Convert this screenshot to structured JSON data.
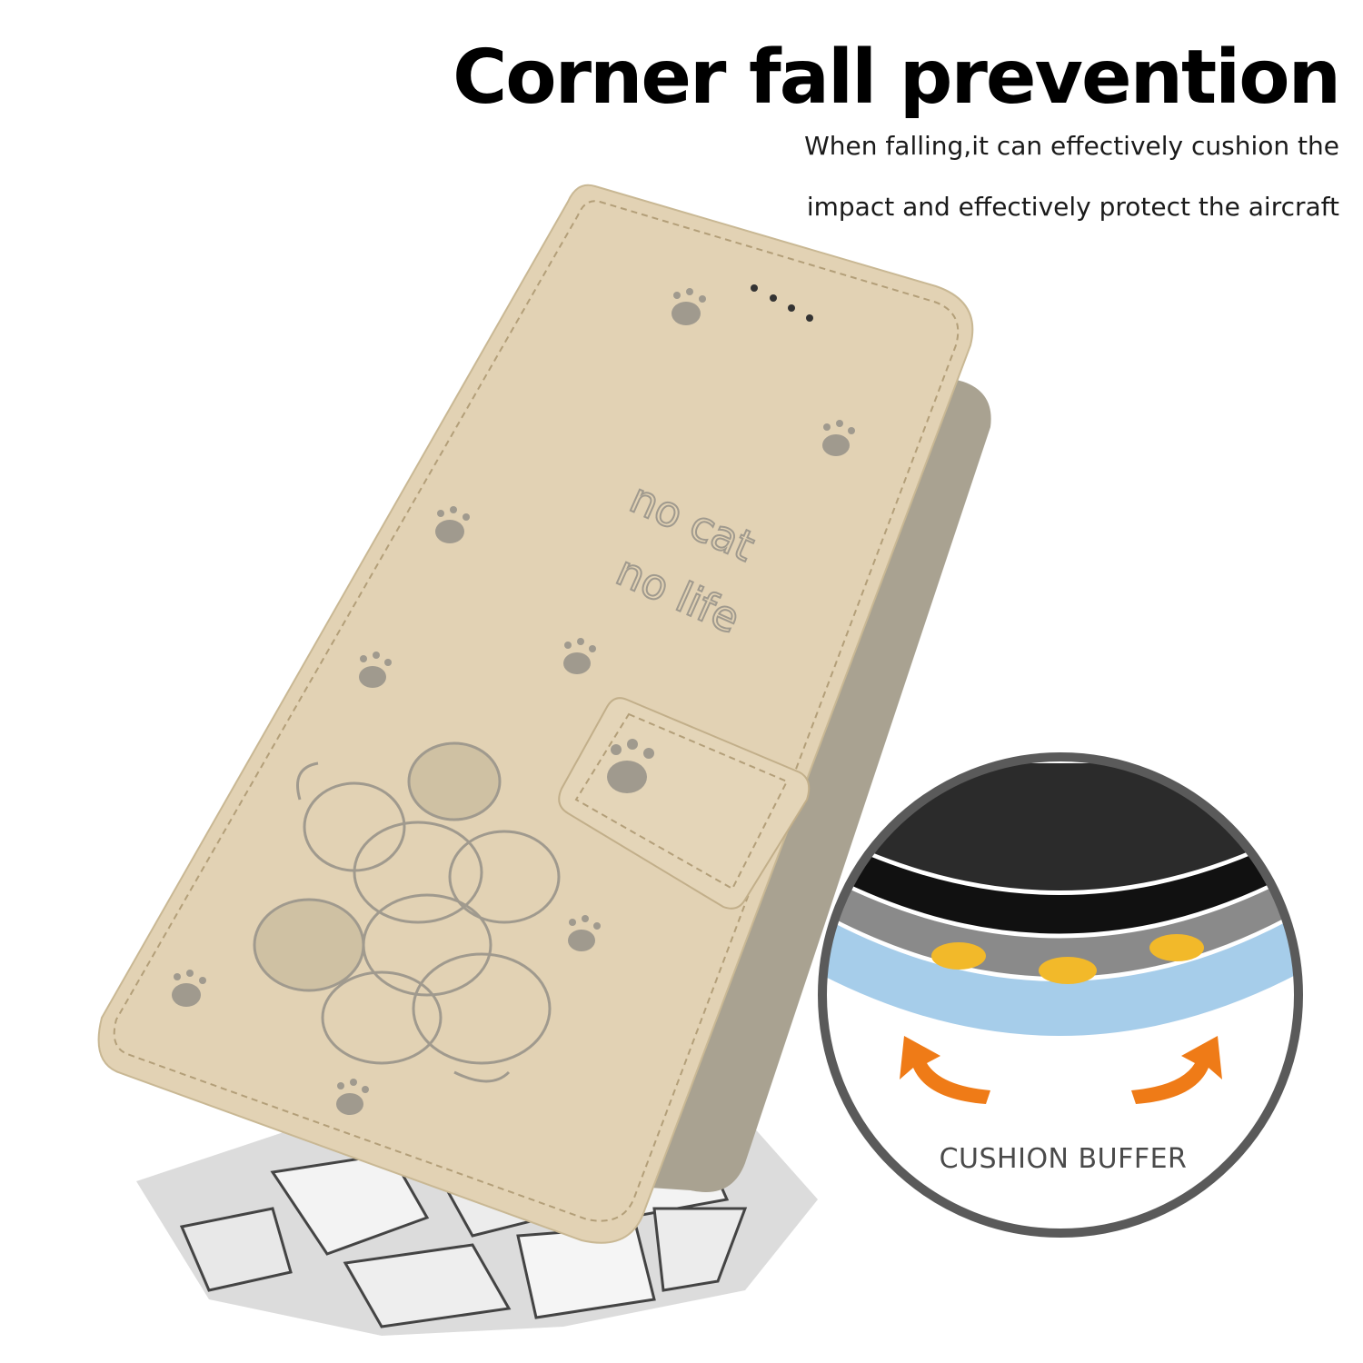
{
  "headline": "Corner fall prevention",
  "description": {
    "line1": "When falling,it can effectively cushion the",
    "line2": "impact and effectively protect the aircraft"
  },
  "case": {
    "embossed_text_line1": "no cat",
    "embossed_text_line2": "no life",
    "leather_color": "#e2d2b4",
    "emboss_color": "#a09a8e"
  },
  "detail_callout": {
    "label": "CUSHION BUFFER",
    "ring_color": "#5a5a5a",
    "cushion_color": "#a6cdea",
    "bumper_color": "#f2b92a",
    "arrow_color": "#ef7b17"
  }
}
